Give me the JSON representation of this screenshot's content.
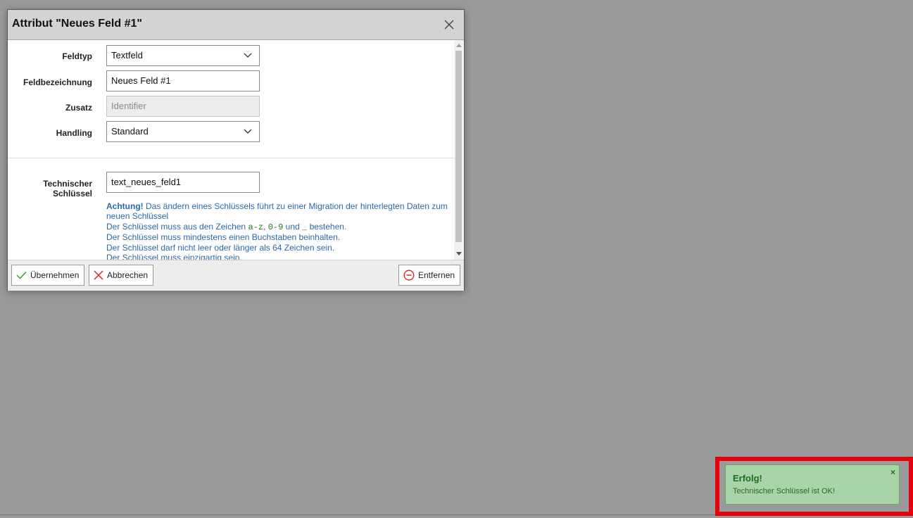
{
  "dialog": {
    "title": "Attribut \"Neues Feld #1\"",
    "close_icon": "close-icon"
  },
  "form": {
    "feldtyp": {
      "label": "Feldtyp",
      "value": "Textfeld"
    },
    "feldbezeichnung": {
      "label": "Feldbezeichnung",
      "value": "Neues Feld #1"
    },
    "zusatz": {
      "label": "Zusatz",
      "placeholder": "Identifier"
    },
    "handling": {
      "label": "Handling",
      "value": "Standard"
    },
    "technischer_schluessel": {
      "label_line1": "Technischer",
      "label_line2": "Schlüssel",
      "value": "text_neues_feld1"
    }
  },
  "hint": {
    "achtung": "Achtung!",
    "line1_rest": " Das ändern eines Schlüssels führt zu einer Migration der hinterlegten Daten zum neuen Schlüssel",
    "line2_prefix": "Der Schlüssel muss aus den Zeichen ",
    "code_az": "a-z",
    "comma": ", ",
    "code_09": "0-9",
    "und": " und ",
    "code_underscore": "_",
    "line2_suffix": " bestehen.",
    "line3": "Der Schlüssel muss mindestens einen Buchstaben beinhalten.",
    "line4": "Der Schlüssel darf nicht leer oder länger als 64 Zeichen sein.",
    "line5": "Der Schlüssel muss einzigartig sein."
  },
  "footer": {
    "apply_label": "Übernehmen",
    "cancel_label": "Abbrechen",
    "remove_label": "Entfernen"
  },
  "toast": {
    "title": "Erfolg!",
    "message": "Technischer Schlüssel ist OK!",
    "close": "×"
  },
  "colors": {
    "backdrop": "#9a9a9a",
    "header": "#d3d3d3",
    "hint_text": "#2a6aa8",
    "code_text": "#1e7a1e",
    "toast_bg": "#a8d4a8",
    "toast_text": "#216b21",
    "highlight": "#e8000a",
    "apply_icon": "#2e9a2e",
    "cancel_icon": "#d81f1f",
    "remove_icon": "#d81f1f"
  }
}
